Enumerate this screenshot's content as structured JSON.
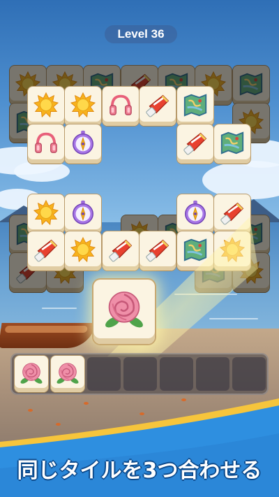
{
  "level": {
    "label": "Level 36"
  },
  "board": {
    "tiles": [
      {
        "icon": "sun-icon",
        "layer": "bottom"
      },
      {
        "icon": "sun-icon",
        "layer": "bottom"
      },
      {
        "icon": "map-icon",
        "layer": "bottom"
      },
      {
        "icon": "lotion-tube-icon",
        "layer": "bottom"
      },
      {
        "icon": "map-icon",
        "layer": "bottom"
      },
      {
        "icon": "sun-icon",
        "layer": "bottom"
      },
      {
        "icon": "map-icon",
        "layer": "bottom"
      },
      {
        "icon": "map-icon",
        "layer": "bottom"
      },
      {
        "icon": "sun-icon",
        "layer": "bottom"
      },
      {
        "icon": "sun-icon",
        "layer": "top"
      },
      {
        "icon": "sun-icon",
        "layer": "top"
      },
      {
        "icon": "headphones-icon",
        "layer": "top"
      },
      {
        "icon": "lotion-tube-icon",
        "layer": "top"
      },
      {
        "icon": "map-icon",
        "layer": "top"
      },
      {
        "icon": "headphones-icon",
        "layer": "top"
      },
      {
        "icon": "compass-icon",
        "layer": "top"
      },
      {
        "icon": "lotion-tube-icon",
        "layer": "top"
      },
      {
        "icon": "map-icon",
        "layer": "top"
      },
      {
        "icon": "map-icon",
        "layer": "bottom"
      },
      {
        "icon": "sun-icon",
        "layer": "bottom"
      },
      {
        "icon": "map-icon",
        "layer": "bottom"
      },
      {
        "icon": "map-icon",
        "layer": "bottom"
      },
      {
        "icon": "lotion-tube-icon",
        "layer": "bottom"
      },
      {
        "icon": "sun-icon",
        "layer": "bottom"
      },
      {
        "icon": "map-icon",
        "layer": "bottom"
      },
      {
        "icon": "sun-icon",
        "layer": "bottom"
      },
      {
        "icon": "map-icon",
        "layer": "bottom"
      },
      {
        "icon": "sun-icon",
        "layer": "top"
      },
      {
        "icon": "compass-icon",
        "layer": "top"
      },
      {
        "icon": "compass-icon",
        "layer": "top"
      },
      {
        "icon": "lotion-tube-icon",
        "layer": "top"
      },
      {
        "icon": "lotion-tube-icon",
        "layer": "top"
      },
      {
        "icon": "sun-icon",
        "layer": "top"
      },
      {
        "icon": "lotion-tube-icon",
        "layer": "top"
      },
      {
        "icon": "lotion-tube-icon",
        "layer": "top"
      },
      {
        "icon": "map-icon",
        "layer": "top"
      },
      {
        "icon": "sun-icon",
        "layer": "top"
      }
    ],
    "selected_tile": {
      "icon": "rose-icon"
    }
  },
  "tray": {
    "capacity": 7,
    "tiles": [
      {
        "icon": "rose-icon"
      },
      {
        "icon": "rose-icon"
      }
    ]
  },
  "banner": {
    "text": "同じタイルを3つ合わせる"
  },
  "colors": {
    "banner_blue": "#2e8fe0",
    "banner_gold": "#f6c53c",
    "tile_face": "#fbf4e2",
    "tile_edge": "#e0cca3"
  }
}
